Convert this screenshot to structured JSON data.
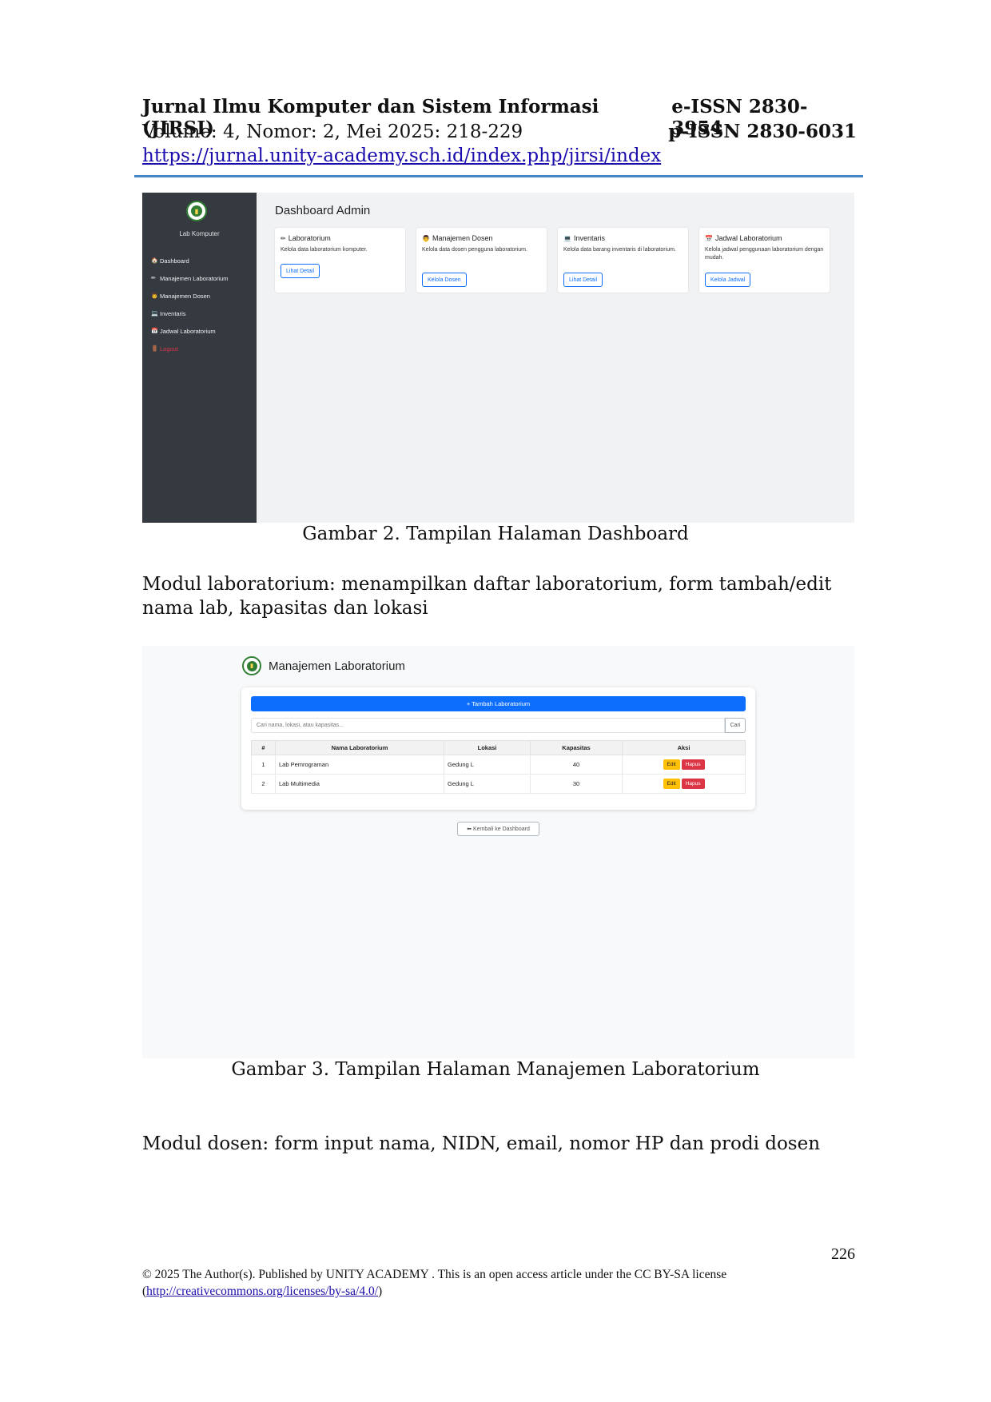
{
  "header": {
    "journal_title": "Jurnal Ilmu Komputer dan Sistem Informasi (JIRSI)",
    "volume": "Volume: 4, Nomor: 2, Mei 2025: 218-229",
    "url": "https://jurnal.unity-academy.sch.id/index.php/jirsi/index",
    "eissn": "e-ISSN 2830-3954",
    "pissn": "p-ISSN 2830-6031"
  },
  "figure2": {
    "sidebar": {
      "lab_name": "Lab Komputer",
      "items": [
        {
          "icon": "home-icon",
          "glyph": "🏠",
          "label": "Dashboard"
        },
        {
          "icon": "pencil-icon",
          "glyph": "✏",
          "label": "Manajemen Laboratorium"
        },
        {
          "icon": "teacher-icon",
          "glyph": "👨",
          "label": "Manajemen Dosen"
        },
        {
          "icon": "laptop-icon",
          "glyph": "💻",
          "label": "Inventaris"
        },
        {
          "icon": "calendar-icon",
          "glyph": "📅",
          "label": "Jadwal Laboratorium"
        },
        {
          "icon": "logout-icon",
          "glyph": "🚪",
          "label": "Logout"
        }
      ]
    },
    "title": "Dashboard Admin",
    "cards": [
      {
        "icon": "pencil-icon",
        "glyph": "✏",
        "title": "Laboratorium",
        "desc": "Kelola data laboratorium komputer.",
        "button": "Lihat Detail"
      },
      {
        "icon": "teacher-icon",
        "glyph": "👨",
        "title": "Manajemen Dosen",
        "desc": "Kelola data dosen pengguna laboratorium.",
        "button": "Kelola Dosen"
      },
      {
        "icon": "laptop-icon",
        "glyph": "💻",
        "title": "Inventaris",
        "desc": "Kelola data barang inventaris di laboratorium.",
        "button": "Lihat Detail"
      },
      {
        "icon": "calendar-icon",
        "glyph": "📅",
        "title": "Jadwal Laboratorium",
        "desc": "Kelola jadwal penggunaan laboratorium dengan mudah.",
        "button": "Kelola Jadwal"
      }
    ],
    "caption": "Gambar 2. Tampilan Halaman Dashboard"
  },
  "paragraph1": "Modul laboratorium: menampilkan daftar laboratorium, form tambah/edit nama lab, kapasitas dan lokasi",
  "figure3": {
    "title": "Manajemen Laboratorium",
    "add_button": "+ Tambah Laboratorium",
    "search_placeholder": "Cari nama, lokasi, atau kapasitas...",
    "search_button": "Cari",
    "columns": [
      "#",
      "Nama Laboratorium",
      "Lokasi",
      "Kapasitas",
      "Aksi"
    ],
    "rows": [
      {
        "no": "1",
        "nama": "Lab Pemrograman",
        "lokasi": "Gedung L",
        "kapasitas": "40"
      },
      {
        "no": "2",
        "nama": "Lab Multimedia",
        "lokasi": "Gedung L",
        "kapasitas": "30"
      }
    ],
    "edit_label": "Edit",
    "delete_label": "Hapus",
    "back_button": "Kembali ke Dashboard",
    "caption": "Gambar 3. Tampilan Halaman Manajemen Laboratorium"
  },
  "paragraph2": "Modul dosen: form input nama, NIDN, email, nomor HP dan prodi dosen",
  "page_number": "226",
  "footer": {
    "license_text": "© 2025 The Author(s). Published by UNITY ACADEMY . This is an open access article under the CC BY-SA license",
    "license_link": "http://creativecommons.org/licenses/by-sa/4.0/",
    "open_paren": "(",
    "close_paren": ")"
  }
}
